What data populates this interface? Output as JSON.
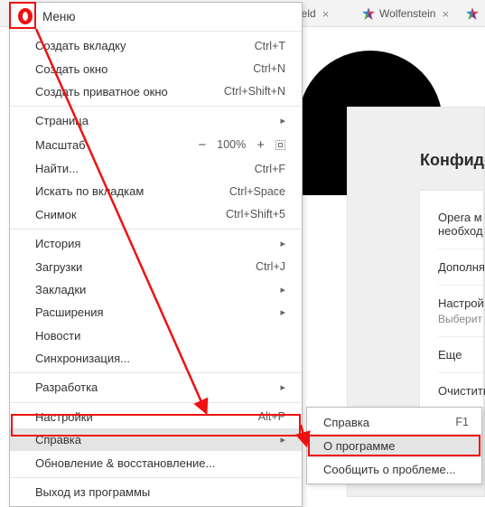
{
  "tabs": {
    "a_label": "efield",
    "b_label": "Wolfenstein"
  },
  "menu": {
    "title": "Меню",
    "items": [
      {
        "label": "Создать вкладку",
        "shortcut": "Ctrl+T"
      },
      {
        "label": "Создать окно",
        "shortcut": "Ctrl+N"
      },
      {
        "label": "Создать приватное окно",
        "shortcut": "Ctrl+Shift+N"
      }
    ],
    "page": {
      "label": "Страница"
    },
    "zoom": {
      "label": "Масштаб",
      "minus": "−",
      "value": "100%",
      "plus": "+"
    },
    "find": {
      "label": "Найти...",
      "shortcut": "Ctrl+F"
    },
    "tabsearch": {
      "label": "Искать по вкладкам",
      "shortcut": "Ctrl+Space"
    },
    "snapshot": {
      "label": "Снимок",
      "shortcut": "Ctrl+Shift+5"
    },
    "history": {
      "label": "История"
    },
    "downloads": {
      "label": "Загрузки",
      "shortcut": "Ctrl+J"
    },
    "bookmarks": {
      "label": "Закладки"
    },
    "extensions": {
      "label": "Расширения"
    },
    "news": {
      "label": "Новости"
    },
    "sync": {
      "label": "Синхронизация..."
    },
    "dev": {
      "label": "Разработка"
    },
    "settings": {
      "label": "Настройки",
      "shortcut": "Alt+P"
    },
    "help": {
      "label": "Справка"
    },
    "update": {
      "label": "Обновление & восстановление..."
    },
    "exit": {
      "label": "Выход из программы"
    }
  },
  "submenu": {
    "help": {
      "label": "Справка",
      "shortcut": "F1"
    },
    "about": "О программе",
    "report": "Сообщить о проблеме..."
  },
  "page": {
    "heading": "Конфиден",
    "row1a": "Opera м",
    "row1b": "необход",
    "row2": "Дополня",
    "row3": "Настрой",
    "row3sub": "Выберит",
    "row4": "Еще",
    "row5": "Очистить"
  }
}
